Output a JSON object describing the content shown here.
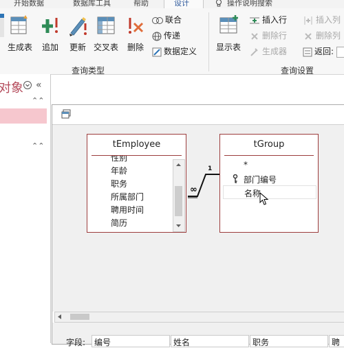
{
  "tabs": {
    "items": [
      "开始数据",
      "数据库工具",
      "帮助",
      "设计",
      "操作说明搜索"
    ]
  },
  "ribbon": {
    "query_type": {
      "label": "查询类型",
      "make_table": "生成表",
      "append": "追加",
      "update": "更新",
      "crosstab": "交叉表",
      "delete": "删除",
      "union": "联合",
      "pass_through": "传递",
      "data_definition": "数据定义"
    },
    "query_setup": {
      "label": "查询设置",
      "show_table": "显示表",
      "insert_rows": "插入行",
      "delete_rows": "删除行",
      "builder": "生成器",
      "insert_columns": "插入列",
      "delete_columns": "删除列",
      "return": "返回:"
    }
  },
  "nav": {
    "title": "对象",
    "collapse": "«"
  },
  "employee_table": {
    "title": "tEmployee",
    "fields": [
      "性别",
      "年龄",
      "职务",
      "所属部门",
      "聘用时间",
      "简历"
    ]
  },
  "group_table": {
    "title": "tGroup",
    "fields": [
      "*",
      "部门编号",
      "名称"
    ]
  },
  "relationship": {
    "one_label": "1",
    "many_label": "∞"
  },
  "grid": {
    "row_label": "字段:",
    "columns": [
      "编号",
      "姓名",
      "职务",
      "聘"
    ]
  },
  "colors": {
    "accent": "#b44b5b",
    "table_border": "#9b3b3b",
    "nav_highlight": "#f6c7ce"
  }
}
